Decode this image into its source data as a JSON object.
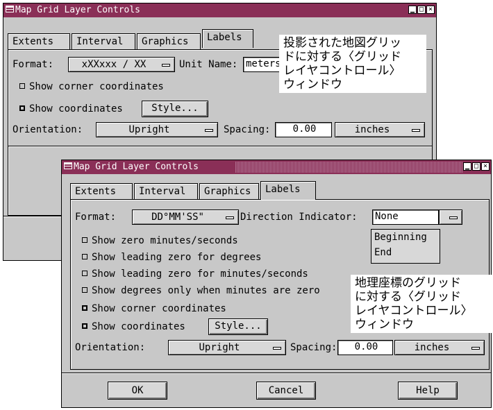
{
  "back_window": {
    "title": "Map Grid Layer Controls",
    "tabs": [
      "Extents",
      "Interval",
      "Graphics",
      "Labels"
    ],
    "active_tab": "Labels",
    "format_label": "Format:",
    "format_value": "xXXxxx / XX",
    "unit_name_label": "Unit Name:",
    "unit_name_value": "meters",
    "show_corner_label": "Show corner coordinates",
    "show_corner_checked": false,
    "show_coords_label": "Show coordinates",
    "show_coords_checked": true,
    "style_button": "Style...",
    "orientation_label": "Orientation:",
    "orientation_value": "Upright",
    "spacing_label": "Spacing:",
    "spacing_value": "0.00",
    "spacing_unit": "inches"
  },
  "back_note": {
    "lines": [
      "投影された地図グリッ",
      "ドに対する〈グリッド",
      "レイヤコントロール〉",
      "ウィンドウ"
    ]
  },
  "front_window": {
    "title": "Map Grid Layer Controls",
    "tabs": [
      "Extents",
      "Interval",
      "Graphics",
      "Labels"
    ],
    "active_tab": "Labels",
    "format_label": "Format:",
    "format_value": "DD°MM'SS\"",
    "direction_label": "Direction Indicator:",
    "direction_value": "None",
    "direction_options": [
      "Beginning",
      "End"
    ],
    "checks": [
      {
        "label": "Show zero minutes/seconds",
        "checked": false
      },
      {
        "label": "Show leading zero for degrees",
        "checked": false
      },
      {
        "label": "Show leading zero for minutes/seconds",
        "checked": false
      },
      {
        "label": "Show degrees only when minutes are zero",
        "checked": false
      },
      {
        "label": "Show corner coordinates",
        "checked": true
      },
      {
        "label": "Show coordinates",
        "checked": true
      }
    ],
    "style_button": "Style...",
    "orientation_label": "Orientation:",
    "orientation_value": "Upright",
    "spacing_label": "Spacing:",
    "spacing_value": "0.00",
    "spacing_unit": "inches",
    "ok_button": "OK",
    "cancel_button": "Cancel",
    "help_button": "Help"
  },
  "front_note": {
    "lines": [
      "地理座標のグリッド",
      "に対する〈グリッド",
      "レイヤコントロール〉",
      "ウィンドウ"
    ]
  }
}
